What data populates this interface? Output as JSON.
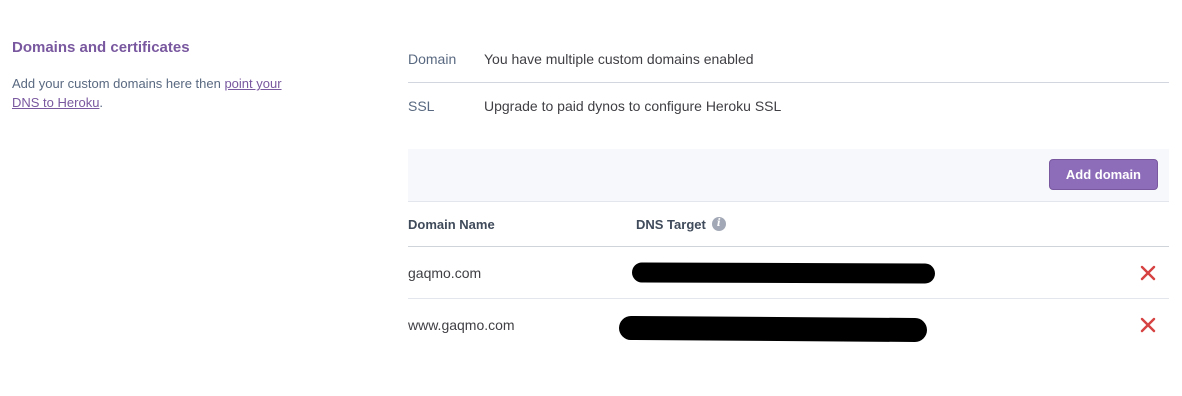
{
  "section": {
    "title": "Domains and certificates",
    "description_prefix": "Add your custom domains here then ",
    "description_link": "point your DNS to Heroku",
    "description_suffix": "."
  },
  "info": {
    "domain_label": "Domain",
    "domain_value": "You have multiple custom domains enabled",
    "ssl_label": "SSL",
    "ssl_value": "Upgrade to paid dynos to configure Heroku SSL"
  },
  "toolbar": {
    "add_domain_label": "Add domain"
  },
  "table": {
    "columns": [
      "Domain Name",
      "DNS Target"
    ],
    "rows": [
      {
        "domain": "gaqmo.com"
      },
      {
        "domain": "www.gaqmo.com"
      }
    ]
  },
  "colors": {
    "accent": "#79589f",
    "button": "#8d6cba",
    "remove": "#d64242"
  },
  "icons": {
    "dns_info": "info-icon",
    "remove": "close-icon"
  }
}
